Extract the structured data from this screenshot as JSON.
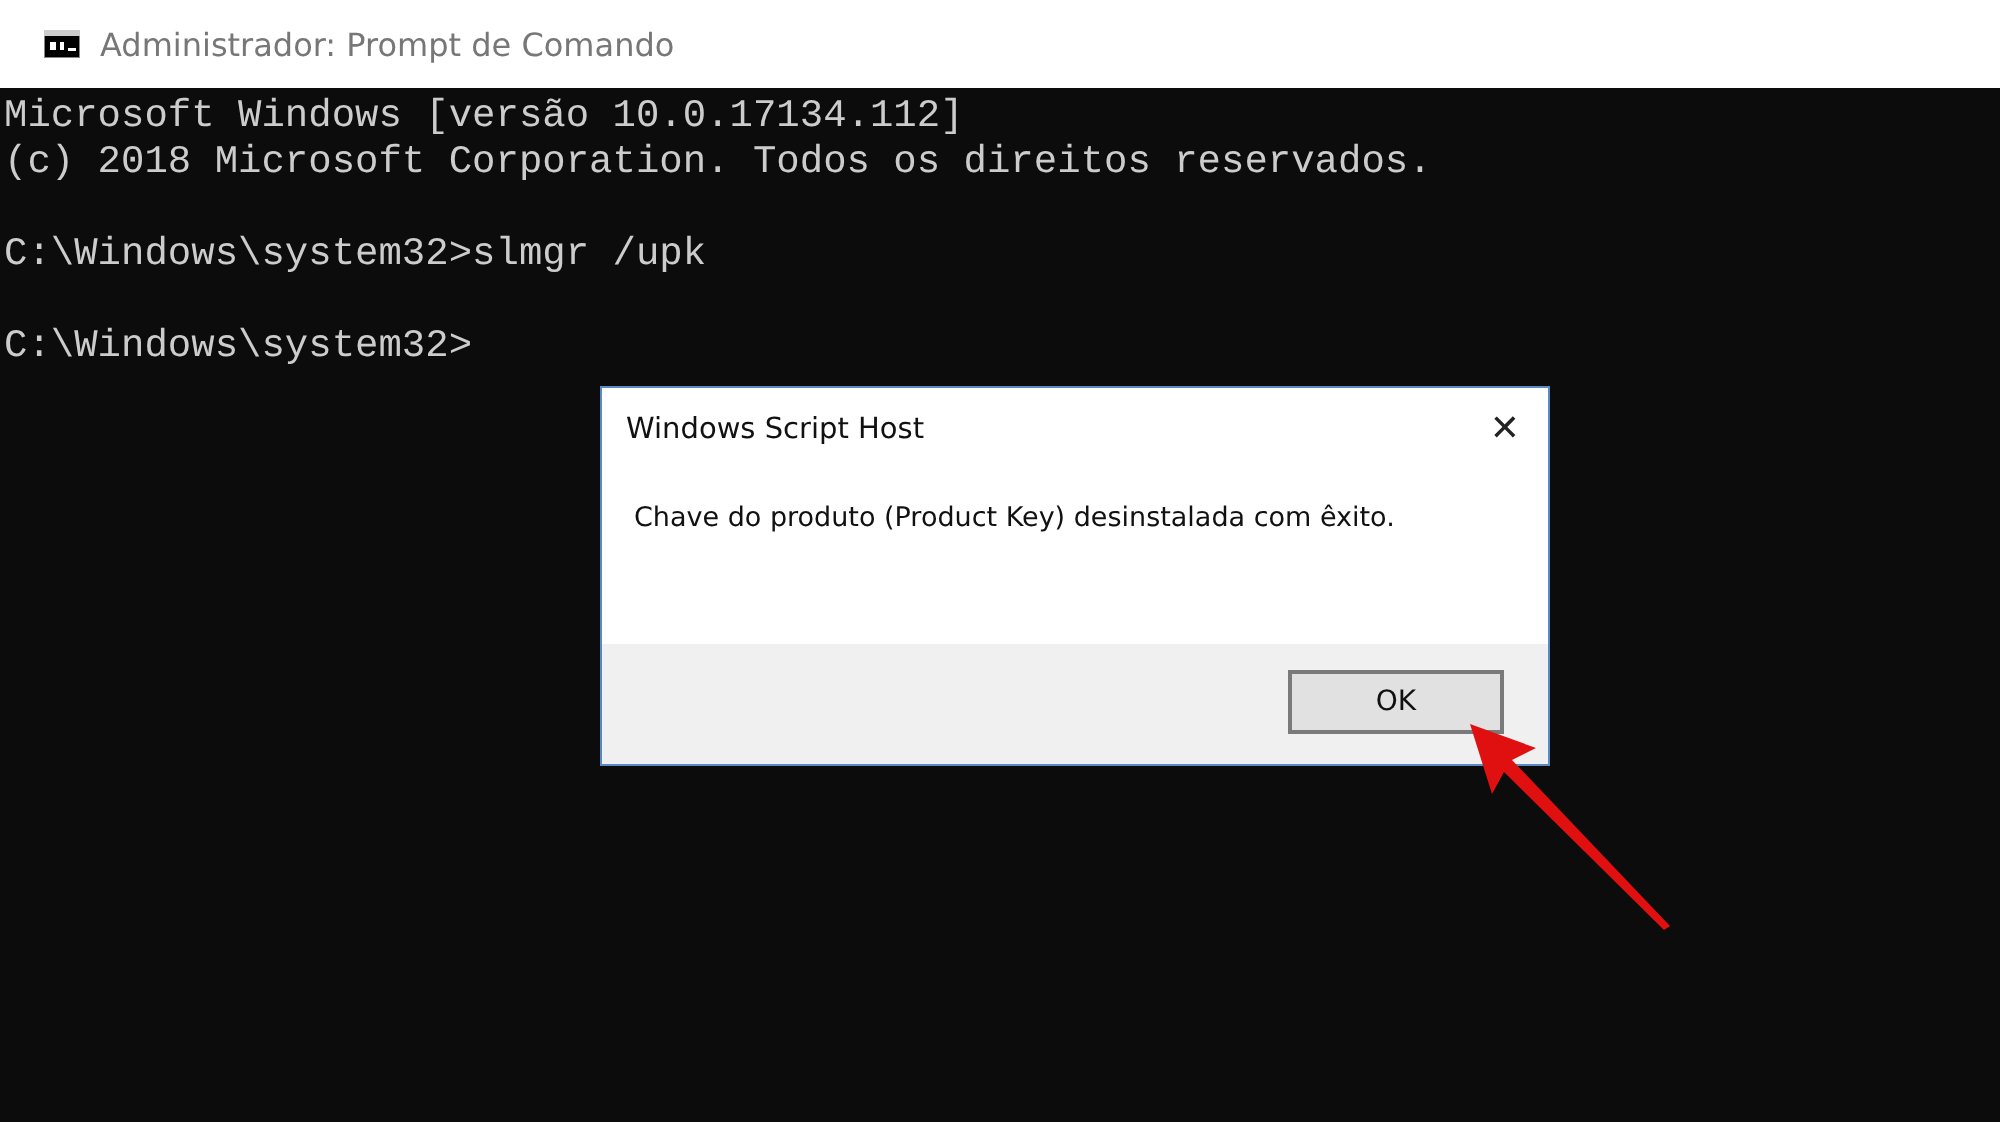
{
  "window": {
    "title": "Administrador: Prompt de Comando"
  },
  "console": {
    "blocks": [
      [
        "Microsoft Windows [versão 10.0.17134.112]",
        "(c) 2018 Microsoft Corporation. Todos os direitos reservados."
      ],
      [
        "C:\\Windows\\system32>slmgr /upk"
      ],
      [
        "C:\\Windows\\system32>"
      ]
    ]
  },
  "dialog": {
    "title": "Windows Script Host",
    "close": "✕",
    "message": "Chave do produto (Product Key) desinstalada com êxito.",
    "buttons": [
      "OK"
    ]
  }
}
